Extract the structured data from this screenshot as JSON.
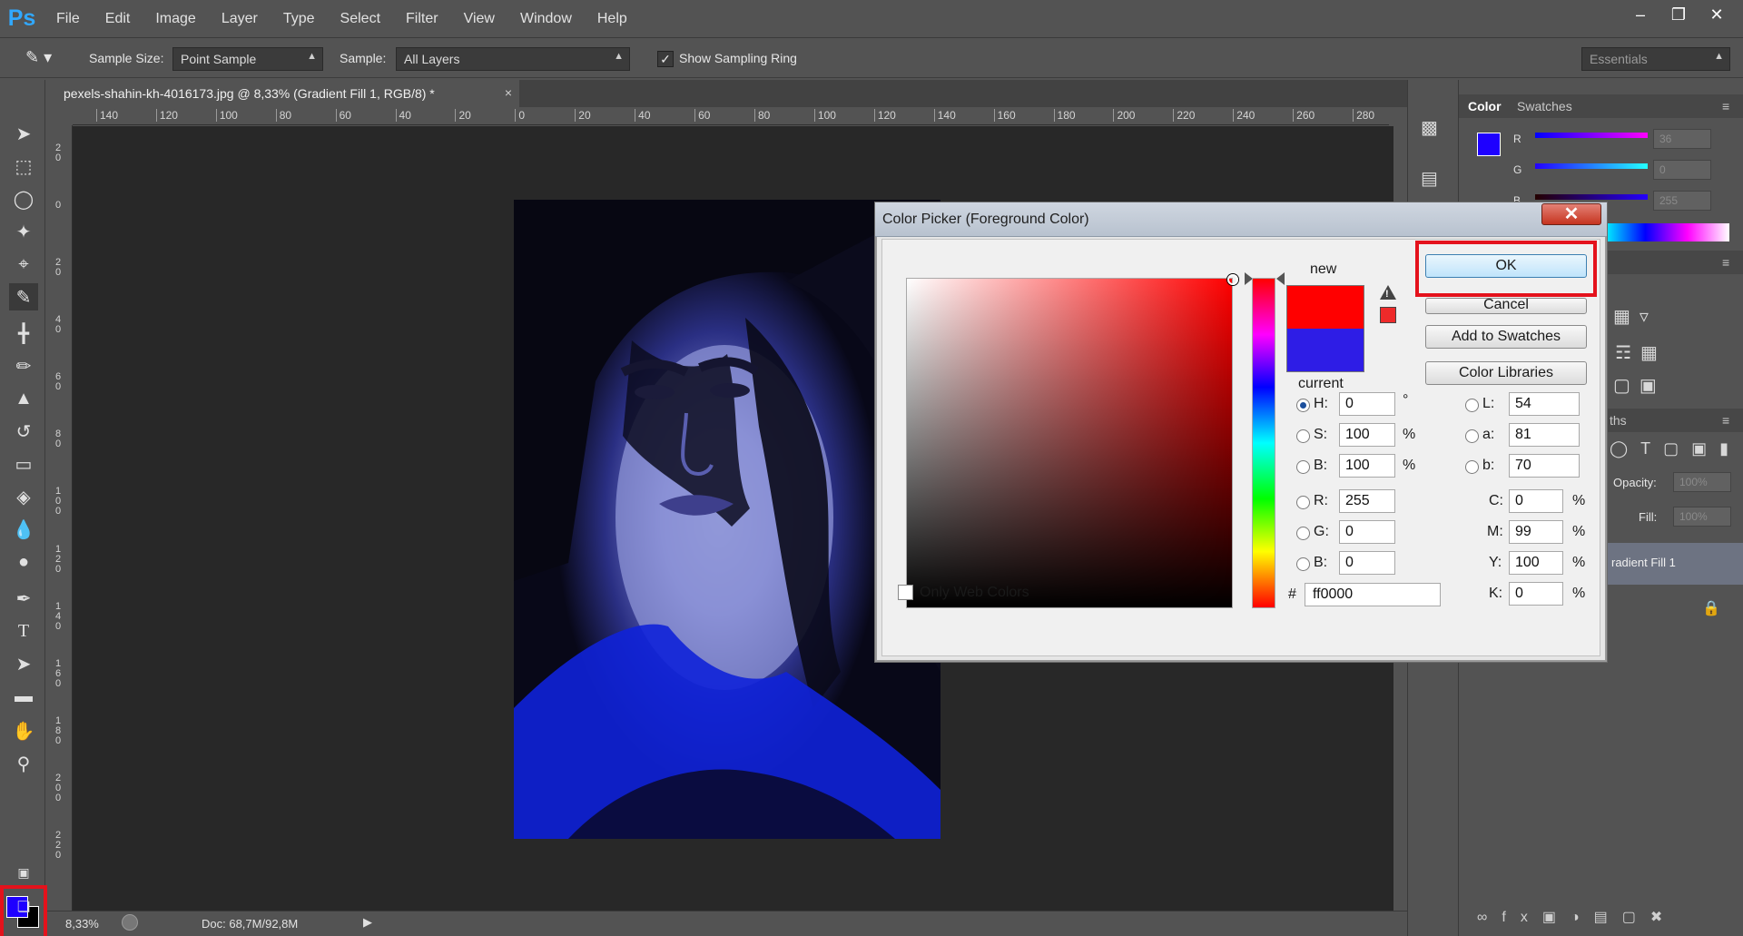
{
  "menubar": {
    "logo": "Ps",
    "items": [
      "File",
      "Edit",
      "Image",
      "Layer",
      "Type",
      "Select",
      "Filter",
      "View",
      "Window",
      "Help"
    ]
  },
  "optionsbar": {
    "sample_size_label": "Sample Size:",
    "sample_size_value": "Point Sample",
    "sample_label": "Sample:",
    "sample_value": "All Layers",
    "show_ring_label": "Show Sampling Ring",
    "show_ring_checked": true,
    "workspace": "Essentials"
  },
  "document": {
    "tab_title": "pexels-shahin-kh-4016173.jpg @ 8,33% (Gradient Fill 1, RGB/8) *",
    "ruler_h_labels": [
      "140",
      "120",
      "100",
      "80",
      "60",
      "40",
      "20",
      "0",
      "20",
      "40",
      "60",
      "80",
      "100",
      "120",
      "140",
      "160",
      "180",
      "200",
      "220",
      "240",
      "260",
      "280"
    ],
    "ruler_v_labels": [
      "2\n0",
      "0",
      "2\n0",
      "4\n0",
      "6\n0",
      "8\n0",
      "1\n0\n0",
      "1\n2\n0",
      "1\n4\n0",
      "1\n6\n0",
      "1\n8\n0",
      "2\n0\n0",
      "2\n2\n0"
    ],
    "zoom": "8,33%",
    "doc_size": "Doc: 68,7M/92,8M"
  },
  "toolbar": {
    "foreground_color": "#1e00ff",
    "background_color": "#000000"
  },
  "color_panel": {
    "tabs": [
      "Color",
      "Swatches"
    ],
    "channels": [
      {
        "label": "R",
        "value": "36"
      },
      {
        "label": "G",
        "value": "0"
      },
      {
        "label": "B",
        "value": "255"
      }
    ]
  },
  "layers_panel": {
    "opacity_label": "Opacity:",
    "opacity_value": "100%",
    "fill_label": "Fill:",
    "fill_value": "100%",
    "layer_name": "radient Fill 1",
    "tab_fragment": "ths"
  },
  "dialog": {
    "title": "Color Picker (Foreground Color)",
    "close": "x",
    "new_label": "new",
    "current_label": "current",
    "new_color": "#ff0000",
    "current_color": "#2e1de6",
    "buttons": {
      "ok": "OK",
      "cancel": "Cancel",
      "add_swatches": "Add to Swatches",
      "libraries": "Color Libraries"
    },
    "hsb": [
      {
        "label": "H:",
        "value": "0",
        "unit": "°",
        "selected": true
      },
      {
        "label": "S:",
        "value": "100",
        "unit": "%",
        "selected": false
      },
      {
        "label": "B:",
        "value": "100",
        "unit": "%",
        "selected": false
      }
    ],
    "rgb": [
      {
        "label": "R:",
        "value": "255"
      },
      {
        "label": "G:",
        "value": "0"
      },
      {
        "label": "B:",
        "value": "0"
      }
    ],
    "lab": [
      {
        "label": "L:",
        "value": "54"
      },
      {
        "label": "a:",
        "value": "81"
      },
      {
        "label": "b:",
        "value": "70"
      }
    ],
    "cmyk": [
      {
        "label": "C:",
        "value": "0",
        "unit": "%"
      },
      {
        "label": "M:",
        "value": "99",
        "unit": "%"
      },
      {
        "label": "Y:",
        "value": "100",
        "unit": "%"
      },
      {
        "label": "K:",
        "value": "0",
        "unit": "%"
      }
    ],
    "hex_label": "#",
    "hex_value": "ff0000",
    "only_web_colors": "Only Web Colors"
  }
}
